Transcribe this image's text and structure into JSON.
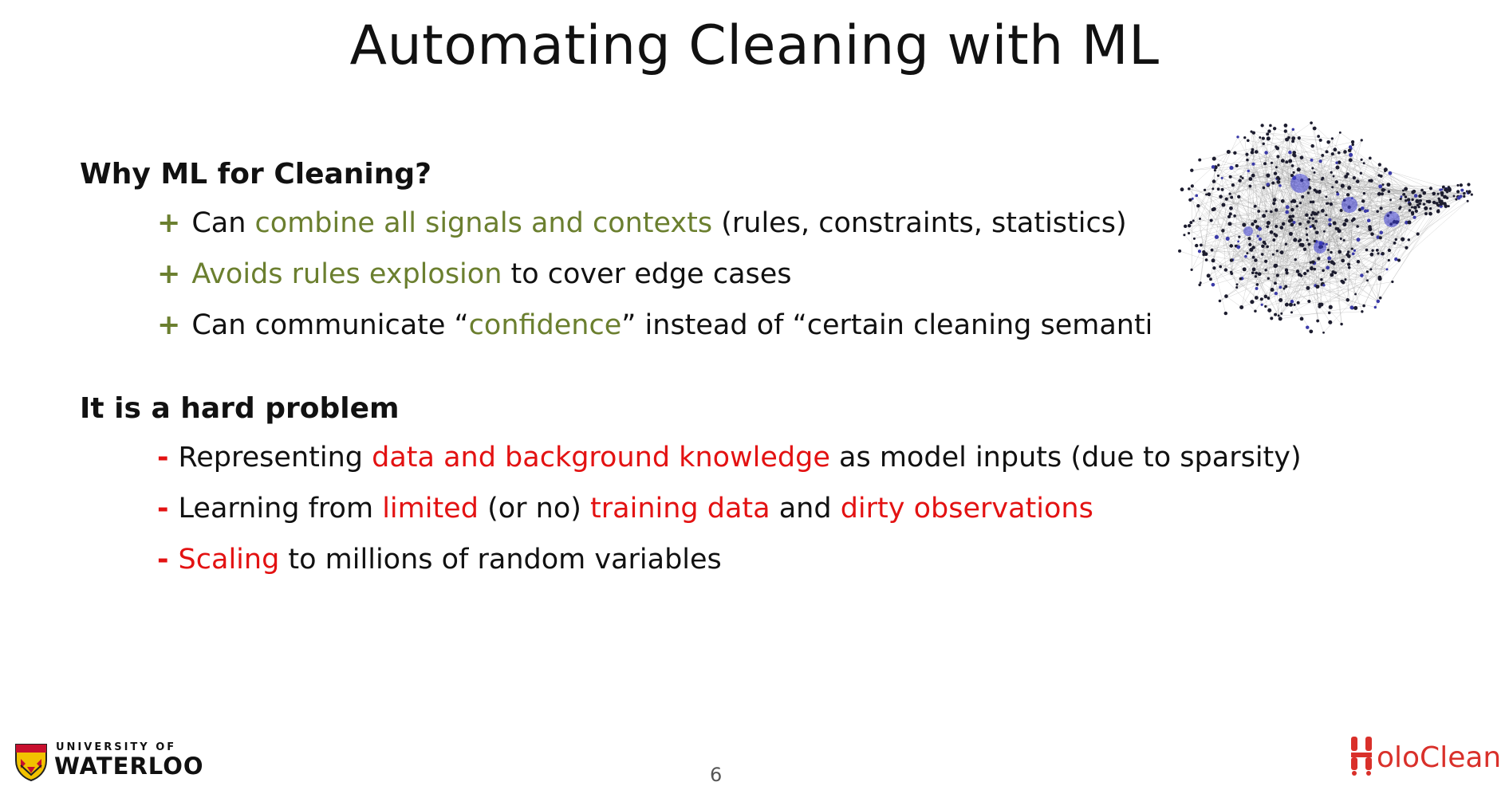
{
  "slide": {
    "title": "Automating Cleaning with ML",
    "page_number": "6"
  },
  "section1": {
    "heading": "Why ML for Cleaning?",
    "bullets": [
      {
        "marker": "+",
        "pre": "Can ",
        "highlight": "combine all signals and contexts",
        "post": " (rules, constraints, statistics)"
      },
      {
        "marker": "+",
        "pre": "",
        "highlight": "Avoids rules explosion",
        "post": " to cover edge cases"
      },
      {
        "marker": "+",
        "pre": "Can communicate “",
        "highlight": "confidence",
        "post": "” instead of “certain cleaning semantic"
      }
    ]
  },
  "section2": {
    "heading": "It is a hard problem",
    "bullets": [
      {
        "marker": "-",
        "pre": "Representing ",
        "h1": "data and background knowledge",
        "post": " as model inputs (due to sparsity)"
      },
      {
        "marker": "-",
        "pre": "Learning from ",
        "h1": "limited",
        "mid1": " (or no) ",
        "h2": "training data",
        "mid2": " and ",
        "h3": "dirty observations"
      },
      {
        "marker": "-",
        "h1": "Scaling",
        "post": " to millions of random variables"
      }
    ]
  },
  "logos": {
    "uw_small": "UNIVERSITY OF",
    "uw_big": "WATERLOO",
    "holoclean_text": "oloClean"
  },
  "icons": {
    "network_graph": "network-graph-image",
    "uw_crest": "uw-crest-icon",
    "holoclean_mark": "holoclean-h-icon"
  },
  "colors": {
    "positive": "#6b7f2f",
    "negative": "#e31212",
    "holoclean": "#d9302a"
  }
}
